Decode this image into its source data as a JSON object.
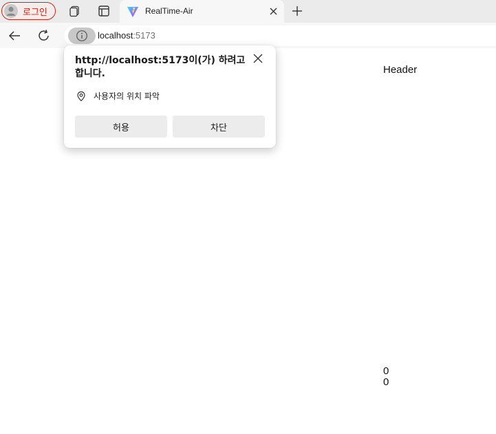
{
  "browser": {
    "profile": {
      "label": "로그인",
      "icon": "user-avatar-icon"
    },
    "tab": {
      "title": "RealTime-Air",
      "favicon": "vite-logo-icon"
    },
    "address": {
      "host": "localhost",
      "port": ":5173"
    }
  },
  "popup": {
    "heading": "http://localhost:5173이(가) 하려고 합니다.",
    "permission": "사용자의 위치 파악",
    "allow_label": "허용",
    "block_label": "차단"
  },
  "page": {
    "header": "Header",
    "lat": "0",
    "lng": "0"
  },
  "colors": {
    "accent": "#c42b1c",
    "tab_bg": "#f7f7f7",
    "strip_bg": "#ebebeb"
  }
}
